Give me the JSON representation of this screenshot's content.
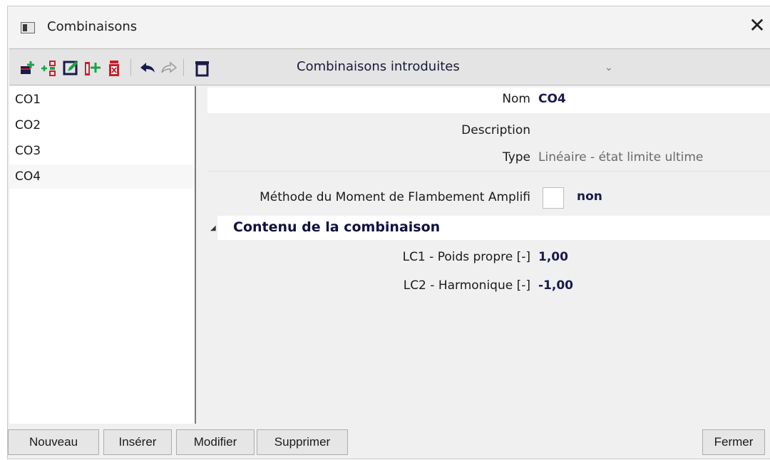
{
  "window": {
    "title": "Combinaisons",
    "close_glyph": "✕"
  },
  "toolbar": {
    "icons": [
      "new-icon",
      "insert-icon",
      "edit-icon",
      "copy-icon",
      "delete-icon",
      "undo-icon",
      "redo-icon",
      "filter-icon"
    ],
    "combo_value": "Combinaisons introduites",
    "combo_arrow": "⌄"
  },
  "list": {
    "items": [
      "CO1",
      "CO2",
      "CO3",
      "CO4"
    ],
    "selected": "CO4"
  },
  "properties": {
    "nom_label": "Nom",
    "nom_value": "CO4",
    "description_label": "Description",
    "description_value": "",
    "type_label": "Type",
    "type_value": "Linéaire - état limite ultime",
    "method_label": "Méthode du Moment de Flambement Amplifi",
    "method_value": "non",
    "section_title": "Contenu de la combinaison",
    "section_toggle": "◢",
    "lc1_label": "LC1 - Poids propre [-]",
    "lc1_value": "1,00",
    "lc2_label": "LC2 - Harmonique [-]",
    "lc2_value": "-1,00"
  },
  "buttons": {
    "nouveau": "Nouveau",
    "inserer": "Insérer",
    "modifier": "Modifier",
    "supprimer": "Supprimer",
    "fermer": "Fermer"
  },
  "colors": {
    "accent_green": "#1aa34a",
    "accent_red": "#c8202a",
    "dark_navy": "#1a1a4a"
  }
}
